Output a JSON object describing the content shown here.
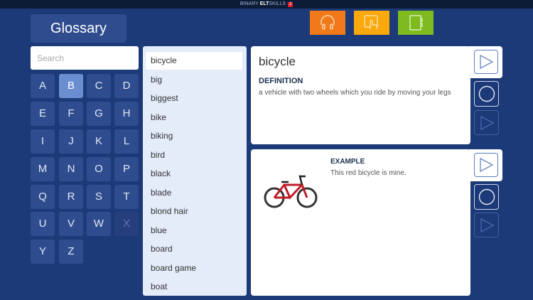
{
  "header": {
    "brand_prefix": "BINARY ",
    "brand_bold": "ELT",
    "brand_suffix": "SKILLS",
    "badge": "2"
  },
  "top_icons": [
    {
      "name": "headphones-icon",
      "color": "#f07a1a"
    },
    {
      "name": "touch-icon",
      "color": "#f9a80d"
    },
    {
      "name": "notebook-icon",
      "color": "#7dbb1f"
    }
  ],
  "glossary_label": "Glossary",
  "search": {
    "placeholder": "Search",
    "value": ""
  },
  "letters": [
    "A",
    "B",
    "C",
    "D",
    "E",
    "F",
    "G",
    "H",
    "I",
    "J",
    "K",
    "L",
    "M",
    "N",
    "O",
    "P",
    "Q",
    "R",
    "S",
    "T",
    "U",
    "V",
    "W",
    "X",
    "Y",
    "Z"
  ],
  "selected_letter": "B",
  "disabled_letters": [
    "X"
  ],
  "words": [
    "bicycle",
    "big",
    "biggest",
    "bike",
    "biking",
    "bird",
    "black",
    "blade",
    "blond hair",
    "blue",
    "board",
    "board game",
    "boat"
  ],
  "selected_word": "bicycle",
  "definition": {
    "word": "bicycle",
    "heading": "DEFINITION",
    "text": "a vehicle with two wheels which you ride by moving your legs"
  },
  "example": {
    "heading": "EXAMPLE",
    "text": "This red bicycle is mine."
  }
}
